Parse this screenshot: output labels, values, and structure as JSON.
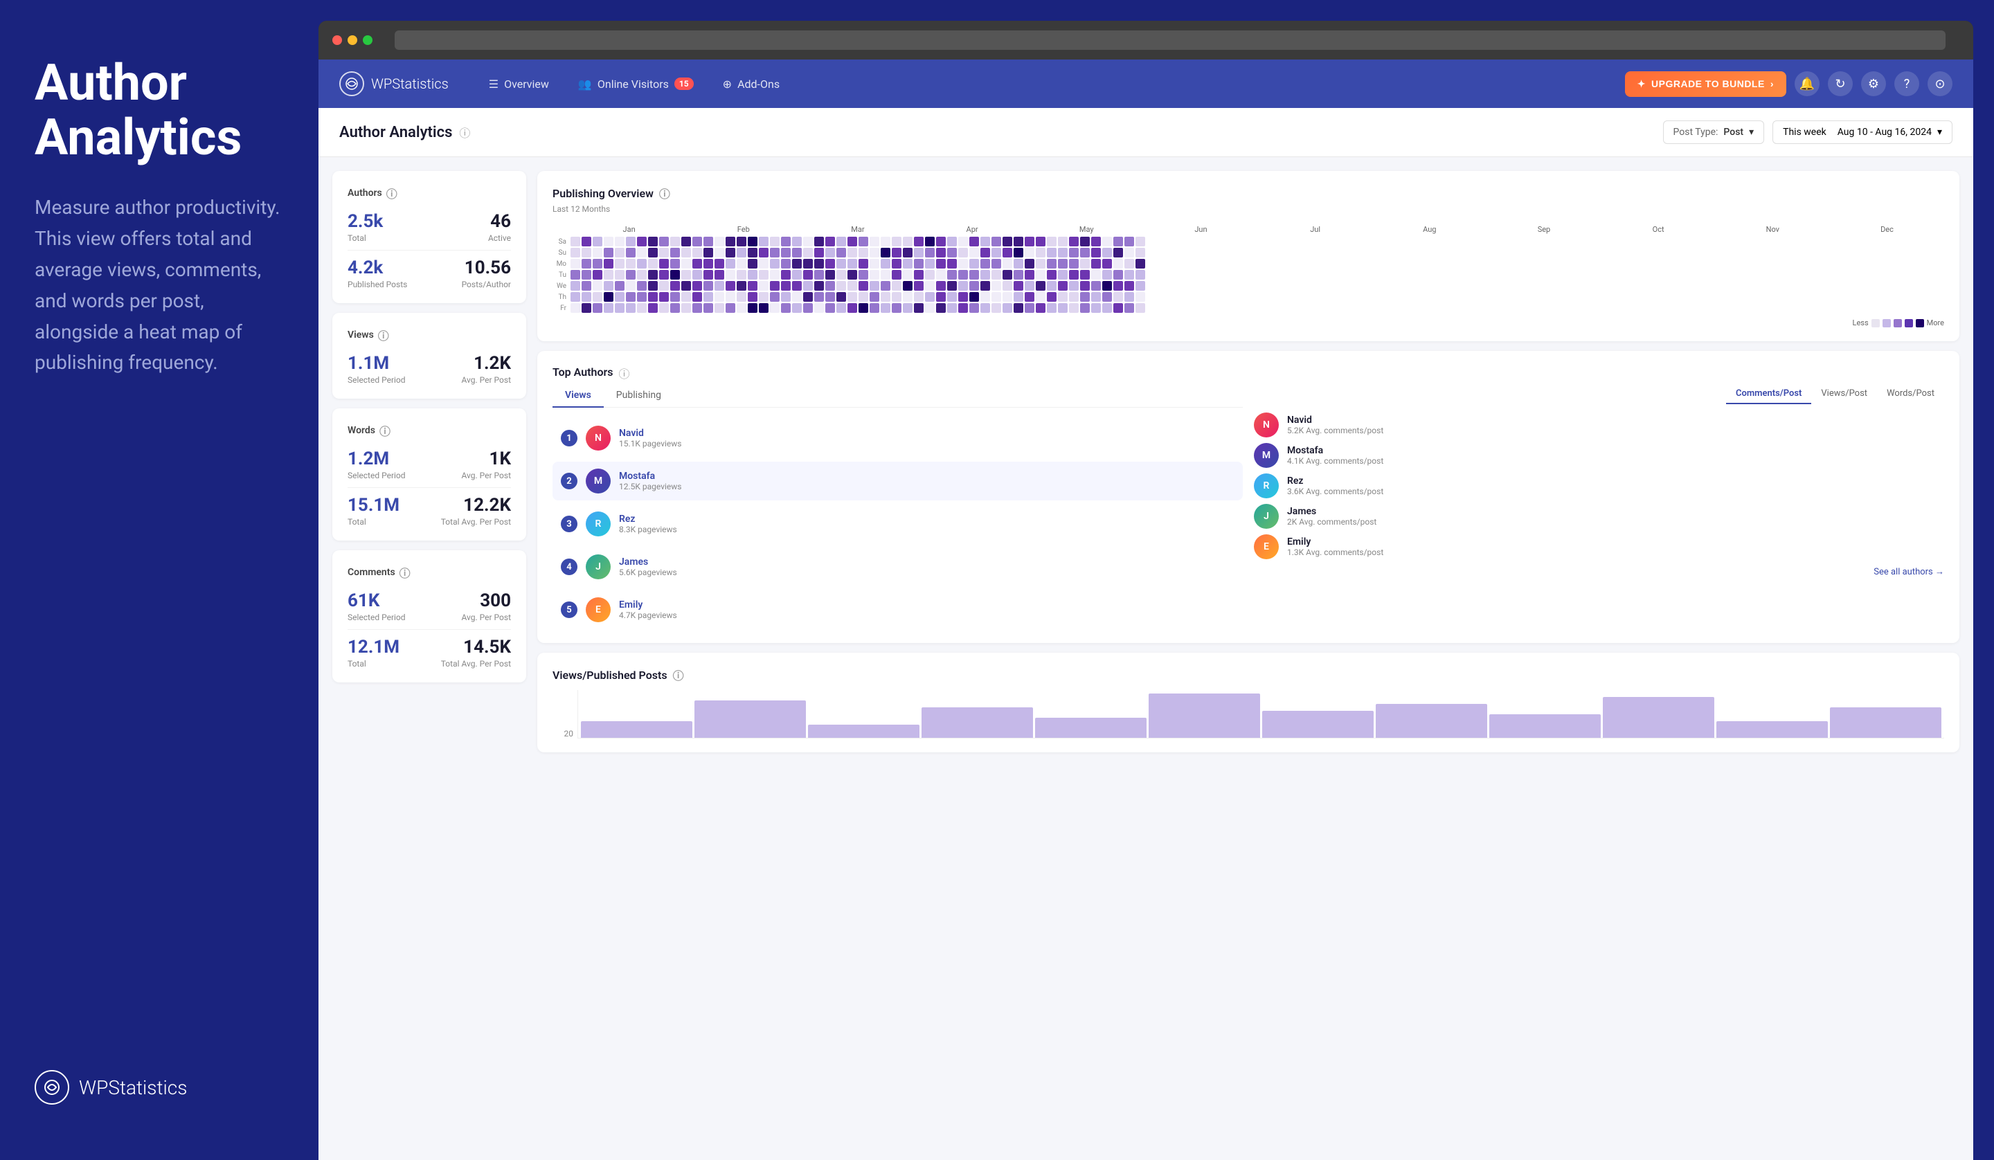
{
  "left_panel": {
    "title": "Author Analytics",
    "description": "Measure author productivity. This view offers total and average views, comments, and words per post, alongside a heat map of publishing frequency.",
    "logo_text_bold": "WP",
    "logo_text_light": "Statistics"
  },
  "browser": {
    "url_placeholder": ""
  },
  "nav": {
    "logo_bold": "WP",
    "logo_light": "Statistics",
    "items": [
      {
        "label": "Overview",
        "icon": "📊"
      },
      {
        "label": "Online Visitors",
        "icon": "👥",
        "badge": "15"
      },
      {
        "label": "Add-Ons",
        "icon": "🧩"
      }
    ],
    "upgrade_btn": "UPGRADE TO BUNDLE",
    "upgrade_icon": "✦"
  },
  "page": {
    "title": "Author Analytics",
    "post_type_label": "Post Type:",
    "post_type_value": "Post",
    "date_label": "This week",
    "date_value": "Aug 10 - Aug 16, 2024"
  },
  "stats": {
    "authors": {
      "title": "Authors",
      "total_value": "2.5k",
      "total_label": "Total",
      "active_value": "46",
      "active_label": "Active",
      "published_value": "4.2k",
      "published_label": "Published Posts",
      "posts_per_author_value": "10.56",
      "posts_per_author_label": "Posts/Author"
    },
    "views": {
      "title": "Views",
      "selected_value": "1.1M",
      "selected_label": "Selected Period",
      "avg_value": "1.2K",
      "avg_label": "Avg. Per Post"
    },
    "words": {
      "title": "Words",
      "selected_value": "1.2M",
      "selected_label": "Selected Period",
      "avg_value": "1K",
      "avg_label": "Avg. Per Post",
      "total_value": "15.1M",
      "total_label": "Total",
      "total_avg_value": "12.2K",
      "total_avg_label": "Total Avg. Per Post"
    },
    "comments": {
      "title": "Comments",
      "selected_value": "61K",
      "selected_label": "Selected Period",
      "avg_value": "300",
      "avg_label": "Avg. Per Post",
      "total_value": "12.1M",
      "total_label": "Total",
      "total_avg_value": "14.5K",
      "total_avg_label": "Total Avg. Per Post"
    }
  },
  "publishing_overview": {
    "title": "Publishing Overview",
    "subtitle": "Last 12 Months",
    "months": [
      "Jan",
      "Feb",
      "Mar",
      "Apr",
      "May",
      "Jun",
      "Jul",
      "Aug",
      "Sep",
      "Oct",
      "Nov",
      "Dec"
    ],
    "days": [
      "Sa",
      "Su",
      "Mo",
      "Tu",
      "We",
      "Th",
      "Fr"
    ],
    "legend_less": "Less",
    "legend_more": "More"
  },
  "top_authors": {
    "title": "Top Authors",
    "tabs": [
      "Views",
      "Publishing"
    ],
    "right_tabs": [
      "Comments/Post",
      "Views/Post",
      "Words/Post"
    ],
    "authors_left": [
      {
        "rank": "1",
        "name": "Navid",
        "metric": "15.1K pageviews",
        "highlighted": false
      },
      {
        "rank": "2",
        "name": "Mostafa",
        "metric": "12.5K pageviews",
        "highlighted": true
      },
      {
        "rank": "3",
        "name": "Rez",
        "metric": "8.3K pageviews",
        "highlighted": false
      },
      {
        "rank": "4",
        "name": "James",
        "metric": "5.6K pageviews",
        "highlighted": false
      },
      {
        "rank": "5",
        "name": "Emily",
        "metric": "4.7K pageviews",
        "highlighted": false
      }
    ],
    "authors_right": [
      {
        "name": "Navid",
        "metric": "5.2K Avg. comments/post"
      },
      {
        "name": "Mostafa",
        "metric": "4.1K Avg. comments/post"
      },
      {
        "name": "Rez",
        "metric": "3.6K Avg. comments/post"
      },
      {
        "name": "James",
        "metric": "2K Avg. comments/post"
      },
      {
        "name": "Emily",
        "metric": "1.3K Avg. comments/post"
      }
    ],
    "see_all": "See all authors →"
  },
  "views_published": {
    "title": "Views/Published Posts",
    "y_axis_value": "20",
    "chart_bars": [
      4,
      10,
      3,
      8,
      5,
      12,
      7,
      9,
      6,
      11,
      4,
      8
    ]
  }
}
